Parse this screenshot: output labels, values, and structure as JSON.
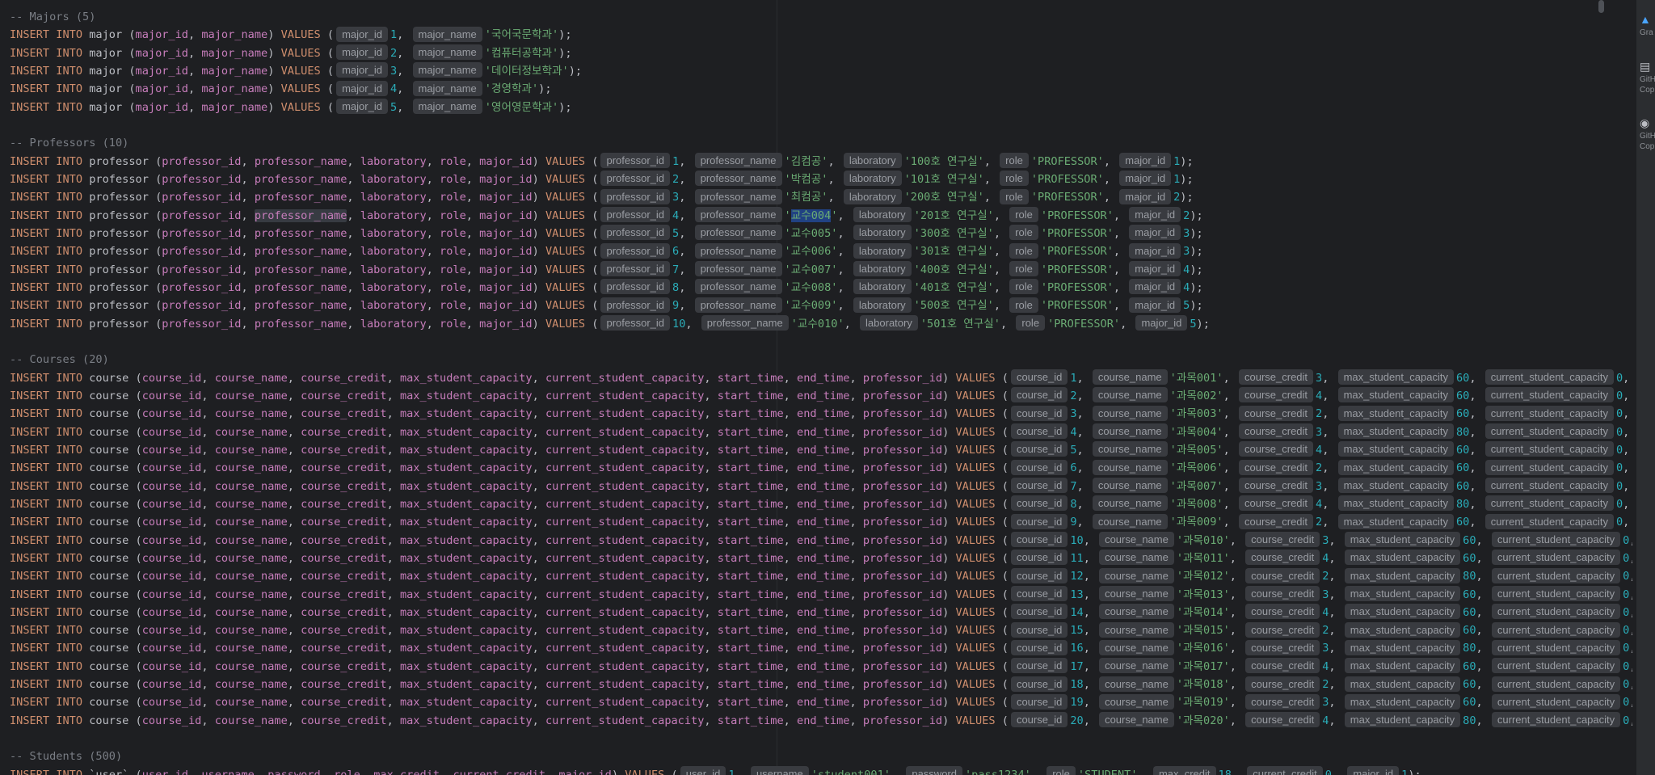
{
  "editor": {
    "comments": {
      "majors": "-- Majors (5)",
      "professors": "-- Professors (10)",
      "courses": "-- Courses (20)",
      "students": "-- Students (500)"
    },
    "majors": [
      {
        "id": "1",
        "name": "'국어국문학과'"
      },
      {
        "id": "2",
        "name": "'컴퓨터공학과'"
      },
      {
        "id": "3",
        "name": "'데이터정보학과'"
      },
      {
        "id": "4",
        "name": "'경영학과'"
      },
      {
        "id": "5",
        "name": "'영어영문학과'"
      }
    ],
    "professors": [
      {
        "id": "1",
        "name": "'김컴공'",
        "lab": "'100호 연구실'",
        "role": "'PROFESSOR'",
        "major": "1"
      },
      {
        "id": "2",
        "name": "'박컴공'",
        "lab": "'101호 연구실'",
        "role": "'PROFESSOR'",
        "major": "1"
      },
      {
        "id": "3",
        "name": "'최컴공'",
        "lab": "'200호 연구실'",
        "role": "'PROFESSOR'",
        "major": "2"
      },
      {
        "id": "4",
        "name": "'교수004'",
        "lab": "'201호 연구실'",
        "role": "'PROFESSOR'",
        "major": "2"
      },
      {
        "id": "5",
        "name": "'교수005'",
        "lab": "'300호 연구실'",
        "role": "'PROFESSOR'",
        "major": "3"
      },
      {
        "id": "6",
        "name": "'교수006'",
        "lab": "'301호 연구실'",
        "role": "'PROFESSOR'",
        "major": "3"
      },
      {
        "id": "7",
        "name": "'교수007'",
        "lab": "'400호 연구실'",
        "role": "'PROFESSOR'",
        "major": "4"
      },
      {
        "id": "8",
        "name": "'교수008'",
        "lab": "'401호 연구실'",
        "role": "'PROFESSOR'",
        "major": "4"
      },
      {
        "id": "9",
        "name": "'교수009'",
        "lab": "'500호 연구실'",
        "role": "'PROFESSOR'",
        "major": "5"
      },
      {
        "id": "10",
        "name": "'교수010'",
        "lab": "'501호 연구실'",
        "role": "'PROFESSOR'",
        "major": "5"
      }
    ],
    "courses": [
      {
        "id": "1",
        "name": "'과목001'",
        "credit": "3",
        "max": "60",
        "cur": "0"
      },
      {
        "id": "2",
        "name": "'과목002'",
        "credit": "4",
        "max": "60",
        "cur": "0"
      },
      {
        "id": "3",
        "name": "'과목003'",
        "credit": "2",
        "max": "60",
        "cur": "0"
      },
      {
        "id": "4",
        "name": "'과목004'",
        "credit": "3",
        "max": "80",
        "cur": "0"
      },
      {
        "id": "5",
        "name": "'과목005'",
        "credit": "4",
        "max": "60",
        "cur": "0"
      },
      {
        "id": "6",
        "name": "'과목006'",
        "credit": "2",
        "max": "60",
        "cur": "0"
      },
      {
        "id": "7",
        "name": "'과목007'",
        "credit": "3",
        "max": "60",
        "cur": "0"
      },
      {
        "id": "8",
        "name": "'과목008'",
        "credit": "4",
        "max": "80",
        "cur": "0"
      },
      {
        "id": "9",
        "name": "'과목009'",
        "credit": "2",
        "max": "60",
        "cur": "0"
      },
      {
        "id": "10",
        "name": "'과목010'",
        "credit": "3",
        "max": "60",
        "cur": "0"
      },
      {
        "id": "11",
        "name": "'과목011'",
        "credit": "4",
        "max": "60",
        "cur": "0"
      },
      {
        "id": "12",
        "name": "'과목012'",
        "credit": "2",
        "max": "80",
        "cur": "0"
      },
      {
        "id": "13",
        "name": "'과목013'",
        "credit": "3",
        "max": "60",
        "cur": "0"
      },
      {
        "id": "14",
        "name": "'과목014'",
        "credit": "4",
        "max": "60",
        "cur": "0"
      },
      {
        "id": "15",
        "name": "'과목015'",
        "credit": "2",
        "max": "60",
        "cur": "0"
      },
      {
        "id": "16",
        "name": "'과목016'",
        "credit": "3",
        "max": "80",
        "cur": "0"
      },
      {
        "id": "17",
        "name": "'과목017'",
        "credit": "4",
        "max": "60",
        "cur": "0"
      },
      {
        "id": "18",
        "name": "'과목018'",
        "credit": "2",
        "max": "60",
        "cur": "0"
      },
      {
        "id": "19",
        "name": "'과목019'",
        "credit": "3",
        "max": "60",
        "cur": "0"
      },
      {
        "id": "20",
        "name": "'과목020'",
        "credit": "4",
        "max": "80",
        "cur": "0"
      }
    ],
    "course_tail_short": "start_",
    "course_tail_long": "star",
    "student": {
      "user_id": "1",
      "username": "'student001'",
      "password": "'pass1234'",
      "role": "'STUDENT'",
      "max_credit": "18",
      "current_credit": "0",
      "major_id": "1"
    }
  },
  "toolstrip": [
    {
      "icon": "gradle-icon",
      "label": "Gra"
    },
    {
      "icon": "github-copilot-chat-icon",
      "label": "GitH Cop"
    },
    {
      "icon": "github-copilot-icon",
      "label": "GitH Cop"
    }
  ],
  "colors": {
    "background": "#1e1f22",
    "keyword": "#cf8e6d",
    "column": "#c77dbb",
    "number": "#2aacb8",
    "string": "#6aab73",
    "comment": "#7a7e85",
    "selection": "#214283"
  }
}
